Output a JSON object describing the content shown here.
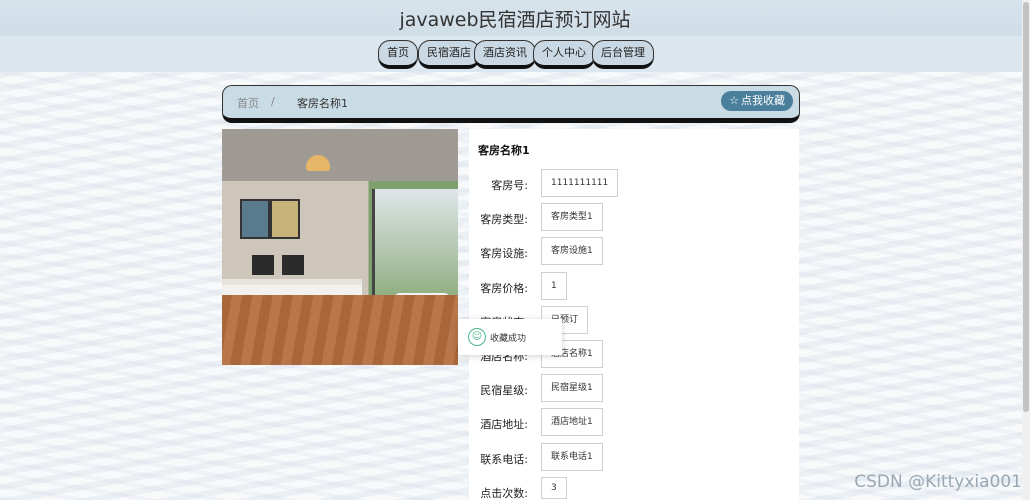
{
  "site": {
    "title": "javaweb民宿酒店预订网站"
  },
  "nav": {
    "items": [
      {
        "label": "首页"
      },
      {
        "label": "民宿酒店"
      },
      {
        "label": "酒店资讯"
      },
      {
        "label": "个人中心"
      },
      {
        "label": "后台管理"
      }
    ]
  },
  "breadcrumb": {
    "home": "首页",
    "separator": "/",
    "current": "客房名称1",
    "favorite_button": "点我收藏"
  },
  "room": {
    "title": "客房名称1",
    "fields": [
      {
        "label": "客房号:",
        "value": "1111111111"
      },
      {
        "label": "客房类型:",
        "value": "客房类型1"
      },
      {
        "label": "客房设施:",
        "value": "客房设施1"
      },
      {
        "label": "客房价格:",
        "value": "1"
      },
      {
        "label": "客房状态:",
        "value": "已预订"
      },
      {
        "label": "酒店名称:",
        "value": "酒店名称1"
      },
      {
        "label": "民宿星级:",
        "value": "民宿星级1"
      },
      {
        "label": "酒店地址:",
        "value": "酒店地址1"
      },
      {
        "label": "联系电话:",
        "value": "联系电话1"
      },
      {
        "label": "点击次数:",
        "value": "3"
      }
    ]
  },
  "toast": {
    "message": "收藏成功"
  },
  "watermark": "CSDN @Kittyxia001",
  "colors": {
    "accent": "#4a7f9c",
    "nav_bg": "#c9d8e2",
    "success": "#4bb58a"
  }
}
